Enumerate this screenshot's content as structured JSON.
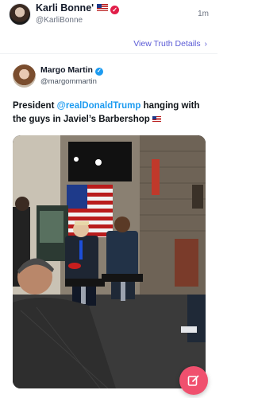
{
  "post": {
    "author_name": "Karli Bonne'",
    "author_handle": "@KarliBonne",
    "timestamp": "1m",
    "view_details_label": "View Truth Details"
  },
  "embedded": {
    "author_name": "Margo Martin",
    "author_handle": "@margommartin",
    "text_before": "President ",
    "mention": "@realDonaldTrump",
    "text_after": " hanging with the guys in Javiel’s Barbershop"
  },
  "colors": {
    "link": "#5b5bd6",
    "mention": "#1d9bf0",
    "fab": "#f0506e",
    "badge_primary": "#e11d48",
    "badge_embedded": "#1d9bf0"
  },
  "icons": {
    "verified": "verified-badge-icon",
    "chevron": "chevron-right-icon",
    "compose": "compose-icon"
  }
}
